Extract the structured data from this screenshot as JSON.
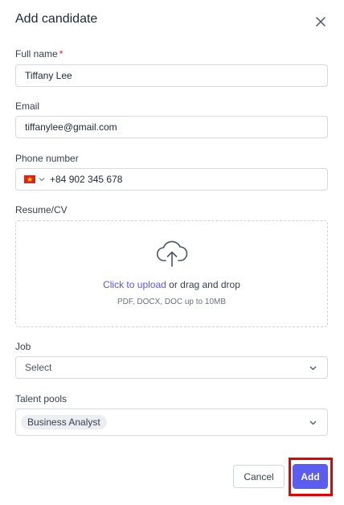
{
  "dialog": {
    "title": "Add candidate"
  },
  "fields": {
    "full_name": {
      "label": "Full name",
      "required_marker": "*",
      "value": "Tiffany Lee"
    },
    "email": {
      "label": "Email",
      "value": "tiffanylee@gmail.com"
    },
    "phone": {
      "label": "Phone number",
      "country_flag": "vietnam-flag",
      "value": "+84 902 345 678"
    },
    "resume": {
      "label": "Resume/CV",
      "upload_link": "Click to upload",
      "upload_text": "or drag and drop",
      "hint": "PDF, DOCX, DOC up to 10MB"
    },
    "job": {
      "label": "Job",
      "placeholder": "Select"
    },
    "talent_pools": {
      "label": "Talent pools",
      "selected": [
        "Business Analyst"
      ]
    }
  },
  "actions": {
    "cancel_label": "Cancel",
    "add_label": "Add"
  },
  "colors": {
    "accent": "#5b5cf0",
    "link": "#5b57e8",
    "required": "#dc2626",
    "highlight": "#e60000"
  }
}
